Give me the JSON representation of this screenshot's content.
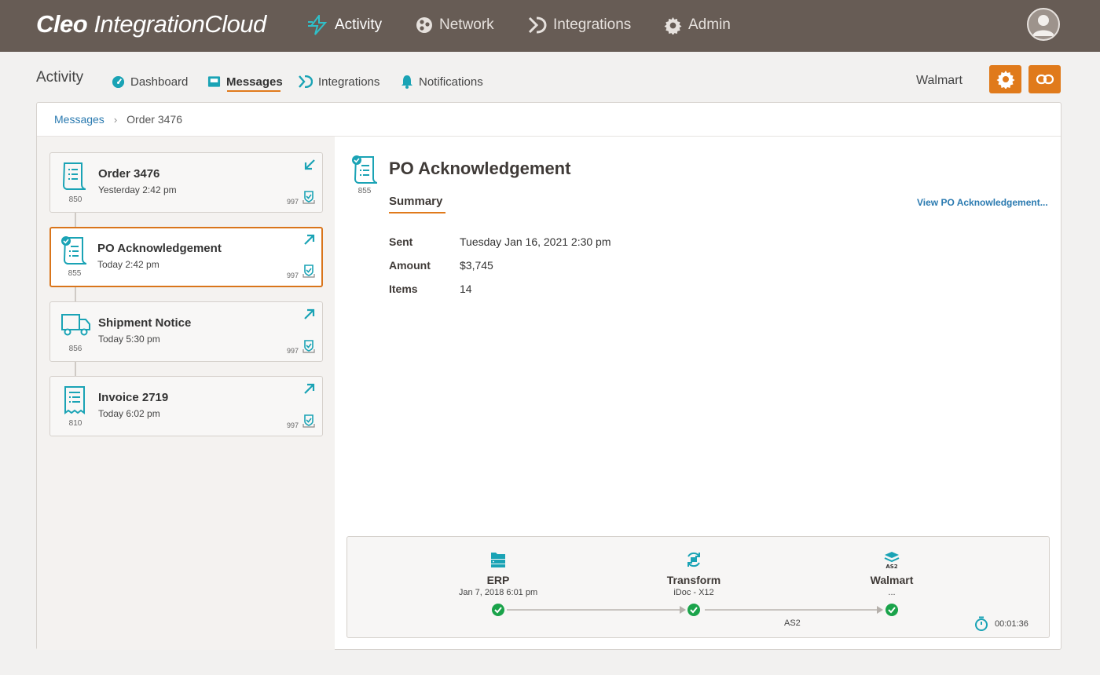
{
  "brand": {
    "name_bold": "Cleo",
    "name_light": "IntegrationCloud"
  },
  "topnav": [
    {
      "label": "Activity",
      "icon": "activity-bolt-icon",
      "active": true
    },
    {
      "label": "Network",
      "icon": "network-icon"
    },
    {
      "label": "Integrations",
      "icon": "integrations-icon"
    },
    {
      "label": "Admin",
      "icon": "gear-icon"
    }
  ],
  "subnav": {
    "section": "Activity",
    "items": [
      {
        "label": "Dashboard",
        "icon": "dashboard-gauge-icon"
      },
      {
        "label": "Messages",
        "icon": "inbox-icon",
        "active": true
      },
      {
        "label": "Integrations",
        "icon": "integrations-icon"
      },
      {
        "label": "Notifications",
        "icon": "bell-icon"
      }
    ],
    "partner": "Walmart"
  },
  "colors": {
    "accent": "#e07a1b",
    "teal": "#1aa3b5",
    "topbar": "#675c55",
    "link": "#2a7ab0",
    "success": "#1aa34a"
  },
  "breadcrumb": {
    "parent": "Messages",
    "current": "Order 3476"
  },
  "messages": [
    {
      "title": "Order 3476",
      "time": "Yesterday 2:42 pm",
      "code": "850",
      "ack": "997",
      "direction": "inbound"
    },
    {
      "title": "PO Acknowledgement",
      "time": "Today 2:42 pm",
      "code": "855",
      "ack": "997",
      "direction": "outbound",
      "selected": true
    },
    {
      "title": "Shipment Notice",
      "time": "Today 5:30 pm",
      "code": "856",
      "ack": "997",
      "direction": "outbound"
    },
    {
      "title": "Invoice 2719",
      "time": "Today 6:02 pm",
      "code": "810",
      "ack": "997",
      "direction": "outbound"
    }
  ],
  "detail": {
    "title": "PO Acknowledgement",
    "code": "855",
    "tab": "Summary",
    "view_link": "View PO Acknowledgement...",
    "fields": [
      {
        "label": "Sent",
        "value": "Tuesday Jan 16, 2021 2:30 pm"
      },
      {
        "label": "Amount",
        "value": "$3,745"
      },
      {
        "label": "Items",
        "value": "14"
      }
    ]
  },
  "flow": {
    "nodes": [
      {
        "name": "ERP",
        "sub": "Jan 7, 2018  6:01 pm",
        "icon": "folder-server-icon"
      },
      {
        "name": "Transform",
        "sub": "iDoc - X12",
        "icon": "transform-cycle-icon"
      },
      {
        "name": "Walmart",
        "sub": "...",
        "icon": "as2-stack-icon",
        "icon_text": "AS2"
      }
    ],
    "protocol": "AS2",
    "duration": "00:01:36"
  }
}
